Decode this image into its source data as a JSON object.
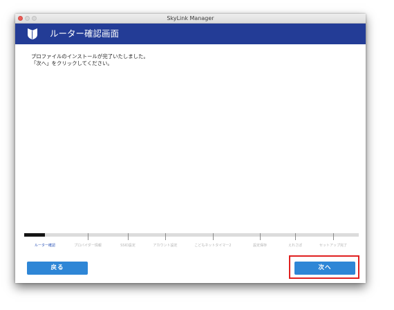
{
  "window": {
    "title": "SkyLink Manager"
  },
  "header": {
    "title": "ルーター確認画面",
    "logo_icon": "shield-logo-icon"
  },
  "message": {
    "line1": "プロファイルのインストールが完了いたしました。",
    "line2": "「次へ」をクリックしてください。"
  },
  "progress": {
    "steps": [
      {
        "label": "ルーター確認",
        "active": true
      },
      {
        "label": "プロバイダー情報",
        "active": false
      },
      {
        "label": "SSID設定",
        "active": false
      },
      {
        "label": "アカウント設定",
        "active": false
      },
      {
        "label": "こどもネットタイマー2",
        "active": false
      },
      {
        "label": "設定保存",
        "active": false
      },
      {
        "label": "えれさぽ",
        "active": false
      },
      {
        "label": "セットアップ完了",
        "active": false
      }
    ],
    "current_step": 1,
    "total_steps": 8
  },
  "buttons": {
    "back": "戻る",
    "next": "次へ"
  },
  "colors": {
    "header_bg": "#233c96",
    "button_bg": "#2e86d6",
    "highlight": "#e0201f",
    "active_step": "#2d55b8"
  }
}
